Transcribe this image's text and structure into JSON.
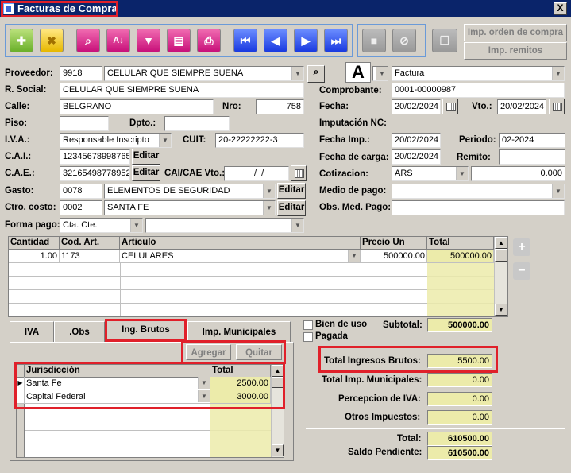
{
  "window": {
    "title": "Facturas de Compra",
    "close": "X"
  },
  "toolbar": {
    "right_buttons": [
      "Imp. orden de compra",
      "Imp. remitos"
    ]
  },
  "doc_letter": "A",
  "form": {
    "proveedor_label": "Proveedor:",
    "proveedor_code": "9918",
    "proveedor_name": "CELULAR QUE SIEMPRE SUENA",
    "razon_label": "R. Social:",
    "razon_value": "CELULAR QUE SIEMPRE SUENA",
    "calle_label": "Calle:",
    "calle_value": "BELGRANO",
    "nro_label": "Nro:",
    "nro_value": "758",
    "piso_label": "Piso:",
    "piso_value": "",
    "dpto_label": "Dpto.:",
    "dpto_value": "",
    "iva_label": "I.V.A.:",
    "iva_value": "Responsable Inscripto",
    "cuit_label": "CUIT:",
    "cuit_value": "20-22222222-3",
    "cai_label": "C.A.I.:",
    "cai_value": "12345678998765",
    "cae_label": "C.A.E.:",
    "cae_value": "32165498778952",
    "caicae_label": "CAI/CAE Vto.:",
    "caicae_value": "  /  /",
    "edit_label": "Editar",
    "gasto_label": "Gasto:",
    "gasto_code": "0078",
    "gasto_name": "ELEMENTOS DE SEGURIDAD",
    "ctro_label": "Ctro. costo:",
    "ctro_code": "0002",
    "ctro_name": "SANTA FE",
    "forma_label": "Forma pago:",
    "forma_value": "Cta. Cte.",
    "forma_extra": "",
    "tipo_value": "Factura",
    "comprobante_label": "Comprobante:",
    "comprobante_value": "0001-00000987",
    "fecha_label": "Fecha:",
    "fecha_value": "20/02/2024",
    "vto_label": "Vto.:",
    "vto_value": "20/02/2024",
    "imputacion_label": "Imputación NC:",
    "imputacion_value": "",
    "fechaimp_label": "Fecha Imp.:",
    "fechaimp_value": "20/02/2024",
    "periodo_label": "Periodo:",
    "periodo_value": "02-2024",
    "fechacarga_label": "Fecha de carga:",
    "fechacarga_value": "20/02/2024",
    "remito_label": "Remito:",
    "remito_value": "",
    "cotizacion_label": "Cotizacion:",
    "cotizacion_currency": "ARS",
    "cotizacion_value": "0.000",
    "medio_label": "Medio de pago:",
    "medio_value": "",
    "obs_label": "Obs. Med. Pago:",
    "obs_value": ""
  },
  "items_grid": {
    "headers": [
      "Cantidad",
      "Cod. Art.",
      "Articulo",
      "Precio Un",
      "Total"
    ],
    "rows": [
      {
        "cantidad": "1.00",
        "cod": "1173",
        "articulo": "CELULARES",
        "precio": "500000.00",
        "total": "500000.00"
      }
    ]
  },
  "tabs": [
    "IVA",
    ".Obs",
    "Ing. Brutos",
    "Imp. Municipales"
  ],
  "ib": {
    "add": "Agregar",
    "remove": "Quitar",
    "headers": [
      "Jurisdicción",
      "Total"
    ],
    "rows": [
      {
        "jur": "Santa Fe",
        "total": "2500.00"
      },
      {
        "jur": "Capital Federal",
        "total": "3000.00"
      }
    ]
  },
  "checks": {
    "bien_de_uso": "Bien de uso",
    "pagada": "Pagada"
  },
  "totals": {
    "subtotal_label": "Subtotal:",
    "subtotal": "500000.00",
    "ib_label": "Total Ingresos Brutos:",
    "ib": "5500.00",
    "mun_label": "Total Imp. Municipales:",
    "mun": "0.00",
    "perc_label": "Percepcion de IVA:",
    "perc": "0.00",
    "otros_label": "Otros Impuestos:",
    "otros": "0.00",
    "total_label": "Total:",
    "total": "610500.00",
    "saldo_label": "Saldo Pendiente:",
    "saldo": "610500.00"
  }
}
